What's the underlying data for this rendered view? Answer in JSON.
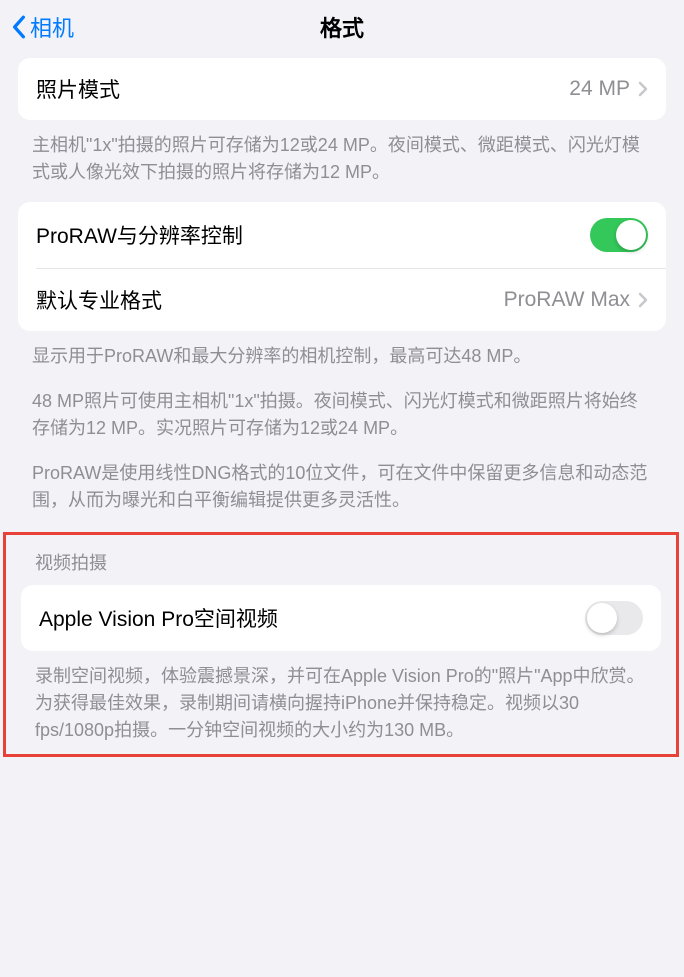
{
  "nav": {
    "back_label": "相机",
    "title": "格式"
  },
  "section1": {
    "photo_mode_label": "照片模式",
    "photo_mode_value": "24 MP",
    "footer": "主相机\"1x\"拍摄的照片可存储为12或24 MP。夜间模式、微距模式、闪光灯模式或人像光效下拍摄的照片将存储为12 MP。"
  },
  "section2": {
    "proraw_control_label": "ProRAW与分辨率控制",
    "default_pro_format_label": "默认专业格式",
    "default_pro_format_value": "ProRAW Max",
    "footer_p1": "显示用于ProRAW和最大分辨率的相机控制，最高可达48 MP。",
    "footer_p2": "48 MP照片可使用主相机\"1x\"拍摄。夜间模式、闪光灯模式和微距照片将始终存储为12 MP。实况照片可存储为12或24 MP。",
    "footer_p3": "ProRAW是使用线性DNG格式的10位文件，可在文件中保留更多信息和动态范围，从而为曝光和白平衡编辑提供更多灵活性。"
  },
  "section3": {
    "header": "视频拍摄",
    "spatial_video_label": "Apple Vision Pro空间视频",
    "footer": "录制空间视频，体验震撼景深，并可在Apple Vision Pro的\"照片\"App中欣赏。为获得最佳效果，录制期间请横向握持iPhone并保持稳定。视频以30 fps/1080p拍摄。一分钟空间视频的大小约为130 MB。"
  }
}
